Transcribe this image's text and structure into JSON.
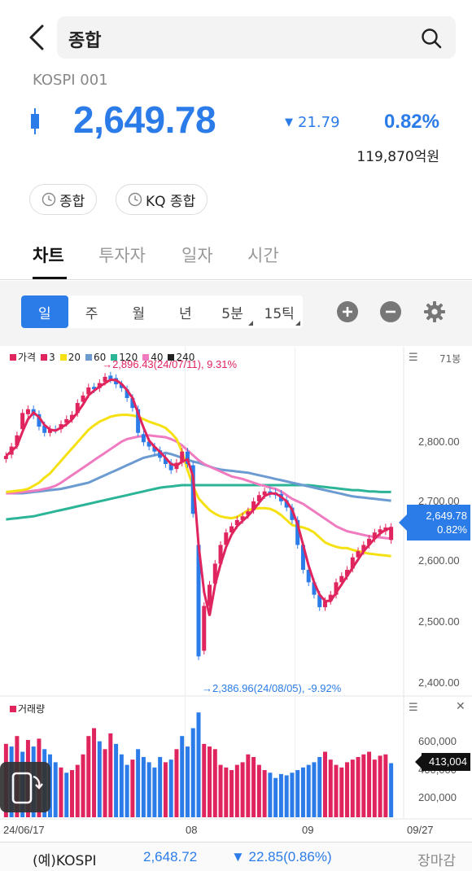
{
  "header": {
    "search_text": "종합"
  },
  "summary": {
    "index_code": "KOSPI 001",
    "price": "2,649.78",
    "change": "21.79",
    "change_pct": "0.82%",
    "trade_amount": "119,870억원",
    "direction": "down",
    "color_down": "#2b7ce9"
  },
  "chips": [
    {
      "label": "종합"
    },
    {
      "label": "KQ 종합"
    }
  ],
  "tabs": [
    {
      "label": "차트",
      "active": true
    },
    {
      "label": "투자자",
      "active": false
    },
    {
      "label": "일자",
      "active": false
    },
    {
      "label": "시간",
      "active": false
    }
  ],
  "periods": [
    {
      "label": "일",
      "active": true
    },
    {
      "label": "주"
    },
    {
      "label": "월"
    },
    {
      "label": "년"
    },
    {
      "label": "5분",
      "has_corner": true
    },
    {
      "label": "15틱",
      "has_corner": true
    }
  ],
  "legend": [
    {
      "label": "가격",
      "color": "#e0245e"
    },
    {
      "label": "3",
      "color": "#e0245e"
    },
    {
      "label": "20",
      "color": "#f5e011"
    },
    {
      "label": "60",
      "color": "#6b9bd1"
    },
    {
      "label": "120",
      "color": "#2bb596"
    },
    {
      "label": "40",
      "color": "#f07bc0"
    },
    {
      "label": "240",
      "color": "#222222"
    }
  ],
  "chart_meta": {
    "candle_count": "71봉"
  },
  "chart_data": {
    "type": "candlestick",
    "ylim": [
      2380,
      2920
    ],
    "y_ticks": [
      {
        "value": 2800,
        "label": "2,800.00"
      },
      {
        "value": 2700,
        "label": "2,700.00"
      },
      {
        "value": 2600,
        "label": "2,600.00"
      },
      {
        "value": 2500,
        "label": "2,500.00"
      },
      {
        "value": 2400,
        "label": "2,400.00"
      }
    ],
    "x_labels": [
      {
        "label": "24/06/17",
        "index": 0
      },
      {
        "label": "08",
        "index": 33
      },
      {
        "label": "09",
        "index": 53
      },
      {
        "label": "09/27",
        "index": 70
      }
    ],
    "high_annotation": {
      "text": "→2,896.43(24/07/11), 9.31%",
      "index": 18,
      "value": 2896.43
    },
    "low_annotation": {
      "text": "→2,386.96(24/08/05), -9.92%",
      "index": 35,
      "value": 2386.96
    },
    "current_price_label": "2,649.78",
    "current_pct_label": "0.82%",
    "close": [
      2763,
      2778,
      2796,
      2832,
      2838,
      2828,
      2810,
      2800,
      2806,
      2805,
      2814,
      2822,
      2829,
      2848,
      2860,
      2873,
      2870,
      2880,
      2890,
      2886,
      2878,
      2872,
      2856,
      2840,
      2800,
      2785,
      2778,
      2770,
      2760,
      2750,
      2740,
      2752,
      2770,
      2750,
      2670,
      2441,
      2522,
      2556,
      2590,
      2620,
      2640,
      2650,
      2660,
      2666,
      2674,
      2690,
      2700,
      2706,
      2702,
      2700,
      2690,
      2680,
      2660,
      2620,
      2580,
      2560,
      2540,
      2520,
      2530,
      2540,
      2560,
      2570,
      2580,
      2600,
      2610,
      2620,
      2630,
      2640,
      2645,
      2648,
      2649
    ],
    "open": [
      2758,
      2765,
      2780,
      2806,
      2830,
      2838,
      2830,
      2812,
      2800,
      2806,
      2806,
      2816,
      2822,
      2832,
      2850,
      2862,
      2874,
      2872,
      2882,
      2892,
      2888,
      2878,
      2870,
      2856,
      2838,
      2798,
      2786,
      2778,
      2772,
      2760,
      2752,
      2742,
      2752,
      2770,
      2748,
      2620,
      2450,
      2522,
      2558,
      2590,
      2620,
      2640,
      2652,
      2660,
      2668,
      2676,
      2690,
      2700,
      2706,
      2704,
      2702,
      2692,
      2680,
      2660,
      2620,
      2580,
      2560,
      2540,
      2520,
      2530,
      2540,
      2560,
      2570,
      2582,
      2600,
      2610,
      2620,
      2630,
      2640,
      2642,
      2628
    ],
    "ma20": [
      2705,
      2706,
      2707,
      2708,
      2710,
      2715,
      2720,
      2728,
      2735,
      2745,
      2755,
      2765,
      2775,
      2785,
      2795,
      2805,
      2812,
      2818,
      2822,
      2826,
      2828,
      2829,
      2829,
      2828,
      2826,
      2822,
      2818,
      2815,
      2812,
      2808,
      2800,
      2790,
      2770,
      2740,
      2715,
      2695,
      2685,
      2676,
      2670,
      2666,
      2664,
      2663,
      2665,
      2670,
      2676,
      2678,
      2679,
      2679,
      2678,
      2674,
      2668,
      2660,
      2652,
      2650,
      2648,
      2645,
      2640,
      2632,
      2624,
      2620,
      2617,
      2615,
      2615,
      2612,
      2610,
      2608,
      2606,
      2605,
      2604,
      2603,
      2602
    ],
    "ma40": [
      2703,
      2703,
      2704,
      2705,
      2706,
      2707,
      2708,
      2710,
      2712,
      2715,
      2720,
      2726,
      2732,
      2738,
      2744,
      2750,
      2756,
      2762,
      2768,
      2774,
      2780,
      2786,
      2790,
      2792,
      2794,
      2795,
      2796,
      2795,
      2794,
      2793,
      2790,
      2786,
      2780,
      2772,
      2764,
      2756,
      2750,
      2746,
      2742,
      2738,
      2734,
      2730,
      2728,
      2726,
      2723,
      2720,
      2717,
      2715,
      2712,
      2710,
      2706,
      2700,
      2694,
      2690,
      2686,
      2680,
      2674,
      2668,
      2662,
      2656,
      2650,
      2646,
      2642,
      2640,
      2638,
      2636,
      2634,
      2633,
      2632,
      2631,
      2630
    ],
    "ma60": [
      2703,
      2703,
      2703,
      2703,
      2704,
      2705,
      2706,
      2707,
      2708,
      2709,
      2710,
      2712,
      2714,
      2716,
      2718,
      2720,
      2724,
      2728,
      2732,
      2736,
      2740,
      2744,
      2748,
      2752,
      2756,
      2760,
      2762,
      2764,
      2766,
      2768,
      2766,
      2763,
      2760,
      2757,
      2754,
      2752,
      2749,
      2746,
      2743,
      2741,
      2740,
      2739,
      2738,
      2737,
      2736,
      2734,
      2732,
      2730,
      2728,
      2726,
      2724,
      2722,
      2720,
      2718,
      2716,
      2714,
      2712,
      2710,
      2708,
      2706,
      2704,
      2702,
      2700,
      2698,
      2697,
      2696,
      2695,
      2694,
      2693,
      2692,
      2691
    ],
    "ma120": [
      2661,
      2662,
      2663,
      2664,
      2665,
      2666,
      2668,
      2670,
      2672,
      2674,
      2676,
      2678,
      2680,
      2682,
      2684,
      2686,
      2688,
      2690,
      2692,
      2694,
      2696,
      2698,
      2700,
      2702,
      2704,
      2706,
      2708,
      2710,
      2712,
      2713,
      2714,
      2715,
      2716,
      2716,
      2716,
      2716,
      2716,
      2716,
      2716,
      2716,
      2716,
      2716,
      2716,
      2716,
      2716,
      2716,
      2716,
      2716,
      2716,
      2716,
      2716,
      2716,
      2716,
      2716,
      2716,
      2716,
      2715,
      2714,
      2713,
      2712,
      2711,
      2710,
      2709,
      2708,
      2708,
      2707,
      2706,
      2706,
      2705,
      2705,
      2705
    ]
  },
  "volume": {
    "label": "거래량",
    "color_up": "#e0245e",
    "color_down": "#2b7ce9",
    "y_ticks": [
      {
        "value": 600000,
        "label": "600,000"
      },
      {
        "value": 400000,
        "label": "400,000"
      },
      {
        "value": 200000,
        "label": "200,000"
      }
    ],
    "current_label": "413,004",
    "values": [
      560,
      540,
      620,
      500,
      590,
      540,
      600,
      520,
      480,
      420,
      380,
      340,
      360,
      400,
      480,
      620,
      680,
      580,
      520,
      640,
      560,
      480,
      400,
      440,
      520,
      460,
      420,
      380,
      460,
      420,
      440,
      520,
      620,
      540,
      680,
      800,
      560,
      540,
      520,
      400,
      380,
      360,
      400,
      420,
      480,
      460,
      400,
      360,
      340,
      300,
      330,
      320,
      340,
      360,
      380,
      400,
      420,
      460,
      500,
      440,
      400,
      380,
      420,
      440,
      460,
      480,
      500,
      440,
      470,
      480,
      413
    ],
    "up": [
      true,
      false,
      true,
      false,
      true,
      false,
      true,
      false,
      false,
      false,
      true,
      false,
      true,
      true,
      true,
      true,
      true,
      false,
      true,
      true,
      false,
      false,
      false,
      true,
      false,
      false,
      false,
      false,
      false,
      true,
      false,
      true,
      false,
      false,
      false,
      false,
      true,
      true,
      true,
      true,
      true,
      true,
      true,
      true,
      true,
      true,
      true,
      true,
      false,
      false,
      false,
      false,
      false,
      false,
      false,
      false,
      false,
      false,
      true,
      true,
      true,
      true,
      true,
      true,
      true,
      true,
      true,
      true,
      true,
      true,
      false
    ]
  },
  "bottom_bar": {
    "name": "(예)KOSPI",
    "price": "2,648.72",
    "change": "▼ 22.85(0.86%)",
    "status": "장마감"
  }
}
